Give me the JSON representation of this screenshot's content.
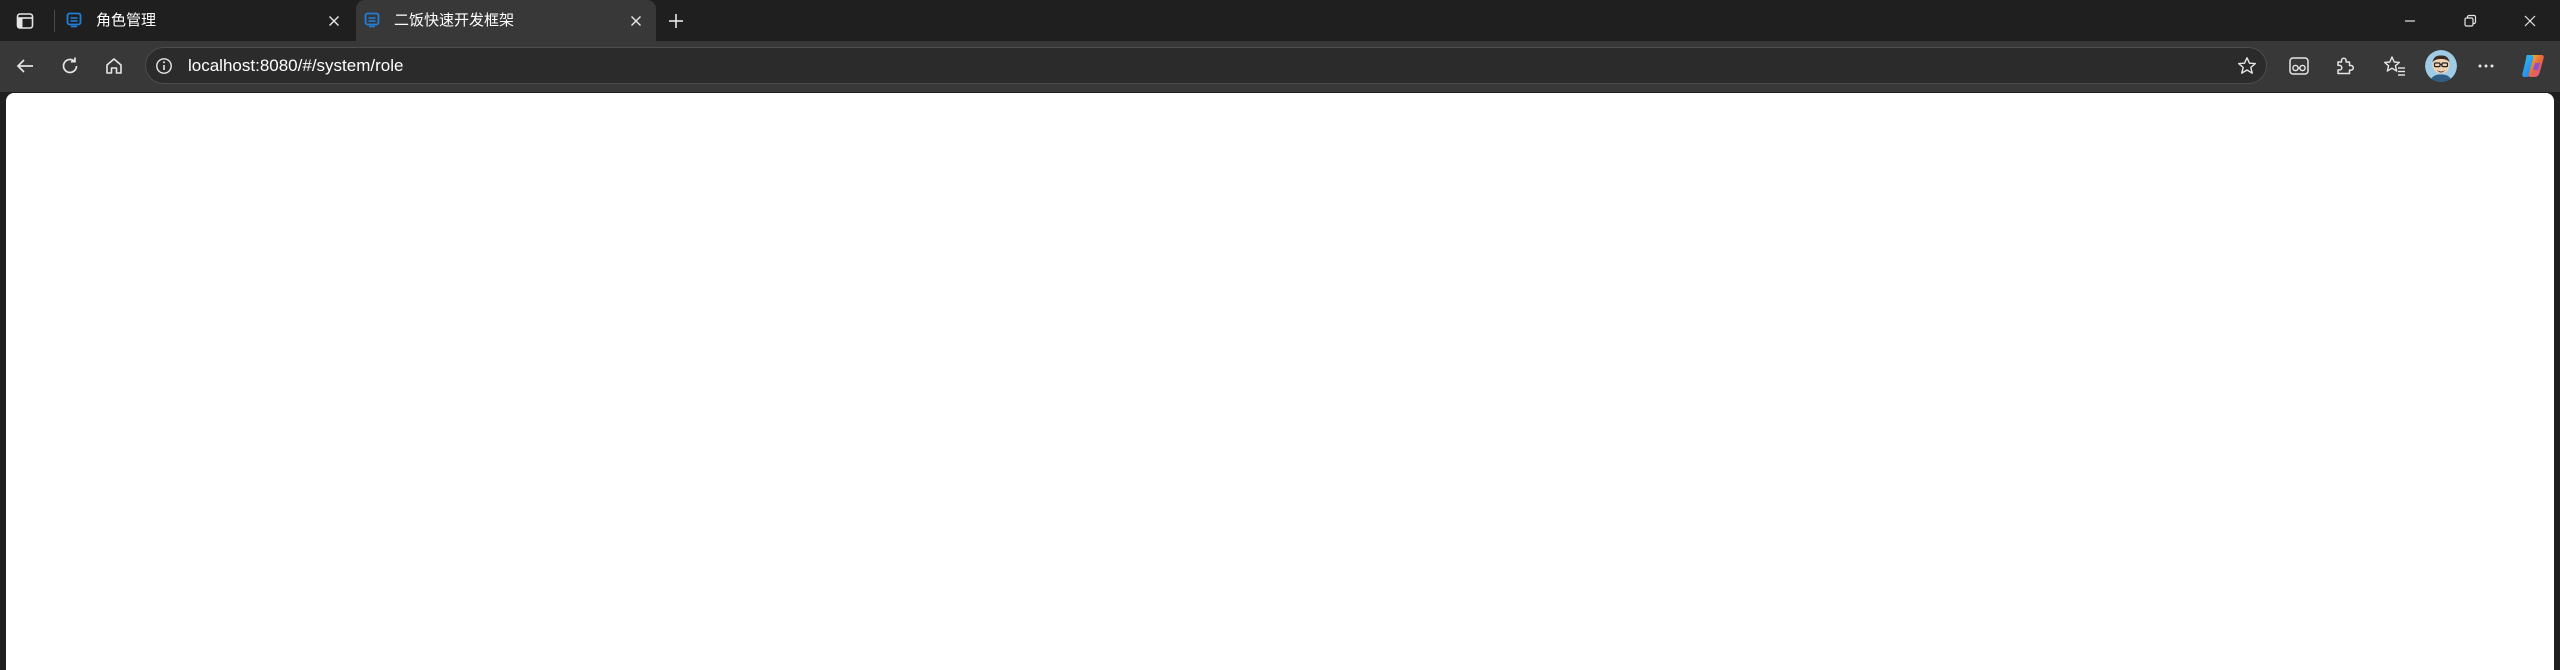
{
  "tabs": [
    {
      "title": "角色管理",
      "active": false,
      "favicon": "vue-admin-icon"
    },
    {
      "title": "二饭快速开发框架",
      "active": true,
      "favicon": "vue-admin-icon"
    }
  ],
  "toolbar": {
    "url": "localhost:8080/#/system/role"
  },
  "icons": {
    "tab_actions": "tab-actions-icon",
    "close": "close-icon",
    "new_tab": "plus-icon",
    "minimize": "minimize-icon",
    "restore": "restore-icon",
    "window_close": "window-close-icon",
    "back": "back-arrow-icon",
    "refresh": "refresh-icon",
    "home": "home-icon",
    "site_info": "info-icon",
    "favorite": "star-icon",
    "reading_mode": "reading-mode-icon",
    "extensions": "puzzle-icon",
    "favorites": "favorites-icon",
    "profile": "avatar",
    "more": "more-icon",
    "copilot": "copilot-icon"
  },
  "colors": {
    "chrome_bg": "#1f1f1f",
    "toolbar_bg": "#383838",
    "favicon_blue": "#1f7fd6",
    "page_bg": "#ffffff"
  }
}
